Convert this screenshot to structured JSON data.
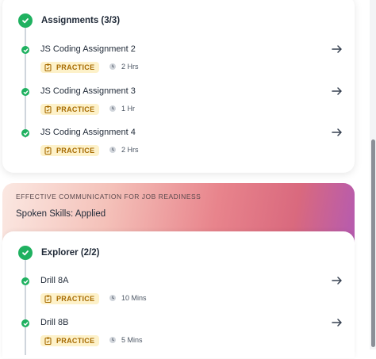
{
  "section1": {
    "title": "Assignments (3/3)",
    "items": [
      {
        "title": "JS Coding Assignment 2",
        "badge": "PRACTICE",
        "duration": "2 Hrs"
      },
      {
        "title": "JS Coding Assignment 3",
        "badge": "PRACTICE",
        "duration": "1 Hr"
      },
      {
        "title": "JS Coding Assignment 4",
        "badge": "PRACTICE",
        "duration": "2 Hrs"
      }
    ]
  },
  "banner": {
    "subtitle": "EFFECTIVE COMMUNICATION FOR JOB READINESS",
    "title": "Spoken Skills: Applied"
  },
  "section2": {
    "title": "Explorer (2/2)",
    "items": [
      {
        "title": "Drill 8A",
        "badge": "PRACTICE",
        "duration": "10 Mins"
      },
      {
        "title": "Drill 8B",
        "badge": "PRACTICE",
        "duration": "5 Mins"
      }
    ]
  },
  "colors": {
    "completed_green": "#1fb160",
    "badge_bg": "#fdf1c9",
    "badge_text": "#a66a00"
  },
  "icons": {
    "complete": "check-circle-icon",
    "item_complete": "check-dot-icon",
    "open": "arrow-right-icon",
    "badge": "clipboard-icon",
    "duration": "clock-icon"
  }
}
